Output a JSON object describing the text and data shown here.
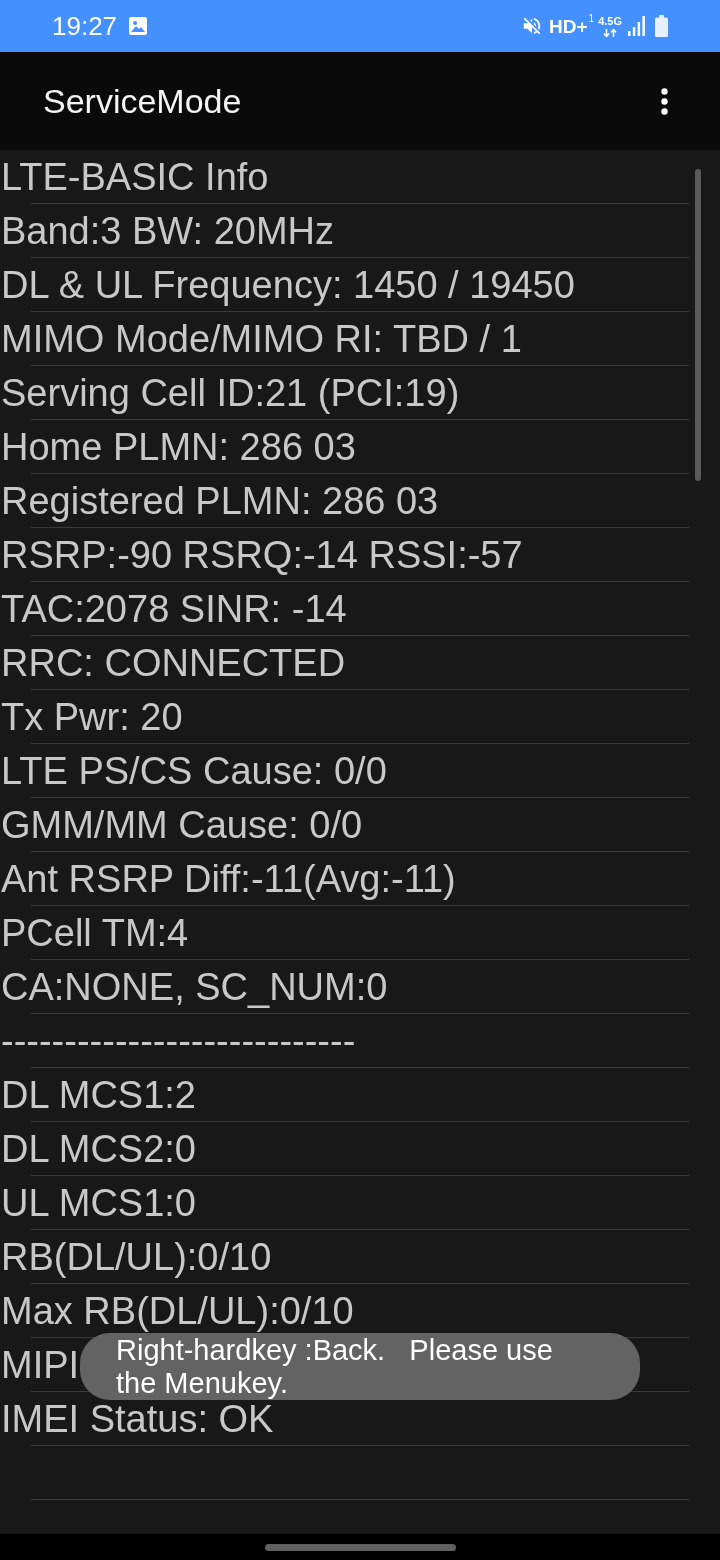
{
  "status_bar": {
    "time": "19:27",
    "hd_label": "HD+",
    "sim_slot": "1",
    "network_type": "4.5G"
  },
  "app_bar": {
    "title": "ServiceMode"
  },
  "info_rows": [
    "LTE-BASIC Info",
    "Band:3 BW: 20MHz",
    "DL & UL Frequency: 1450 / 19450",
    "MIMO Mode/MIMO RI: TBD / 1",
    "Serving Cell ID:21 (PCI:19)",
    "Home PLMN: 286 03",
    "Registered PLMN: 286 03",
    "RSRP:-90 RSRQ:-14 RSSI:-57",
    "TAC:2078 SINR: -14",
    "RRC: CONNECTED",
    "Tx Pwr: 20",
    "LTE PS/CS Cause: 0/0",
    "GMM/MM Cause: 0/0",
    "Ant RSRP Diff:-11(Avg:-11)",
    "PCell TM:4",
    "CA:NONE, SC_NUM:0",
    "----------------------------",
    "DL MCS1:2",
    "DL MCS2:0",
    "UL MCS1:0",
    "RB(DL/UL):0/10",
    "Max RB(DL/UL):0/10",
    "MIPI",
    "IMEI Status: OK"
  ],
  "toast": {
    "message": "Right-hardkey :Back.   Please use the Menukey."
  }
}
